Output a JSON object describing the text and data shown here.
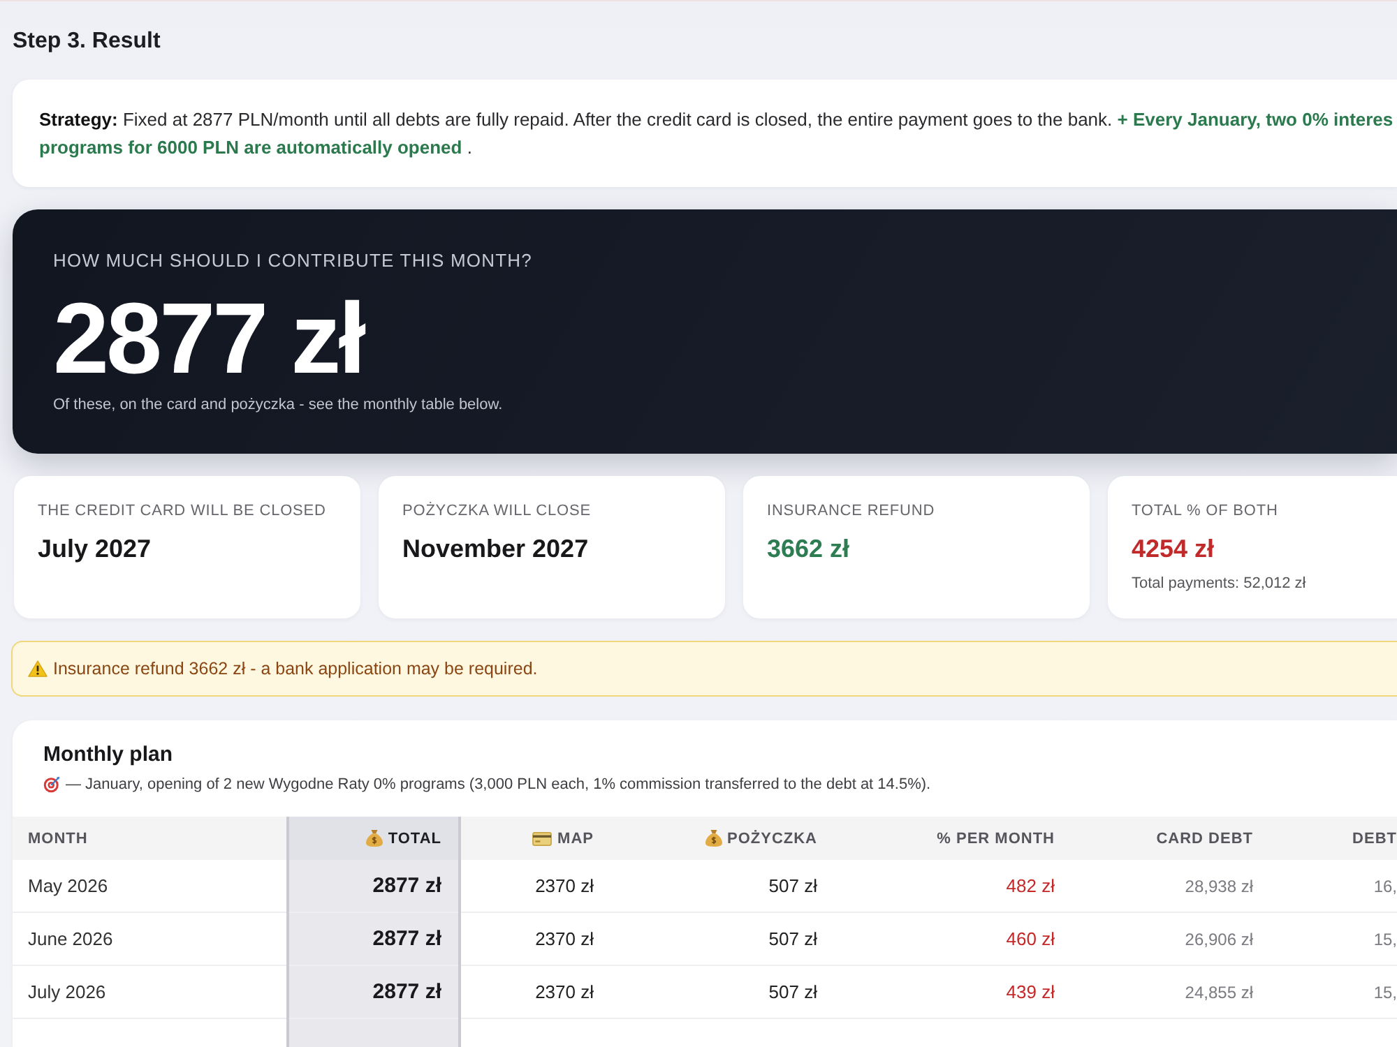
{
  "page": {
    "title": "Step 3. Result"
  },
  "strategy": {
    "label": "Strategy:",
    "text": "Fixed at 2877 PLN/month until all debts are fully repaid. After the credit card is closed, the entire payment goes to the bank.",
    "highlight": "+ Every January, two 0% interes\nprograms for 6000 PLN are automatically opened",
    "tail": "."
  },
  "hero": {
    "label": "HOW MUCH SHOULD I CONTRIBUTE THIS MONTH?",
    "amount": "2877 zł",
    "note": "Of these, on the card and pożyczka - see the monthly table below."
  },
  "stats": [
    {
      "label": "THE CREDIT CARD WILL BE CLOSED",
      "value": "July 2027",
      "kind": "neutral"
    },
    {
      "label": "POŻYCZKA WILL CLOSE",
      "value": "November 2027",
      "kind": "neutral"
    },
    {
      "label": "INSURANCE REFUND",
      "value": "3662 zł",
      "kind": "positive"
    },
    {
      "label": "TOTAL % OF BOTH",
      "value": "4254 zł",
      "kind": "negative",
      "note": "Total payments: 52,012 zł"
    }
  ],
  "alert": {
    "kind": "warning",
    "text": "Insurance refund 3662 zł - a bank application may be required."
  },
  "plan": {
    "title": "Monthly plan",
    "note": "— January, opening of 2 new Wygodne Raty 0% programs (3,000 PLN each, 1% commission transferred to the debt at 14.5%).",
    "columns": [
      {
        "label": "MONTH",
        "kind": "month"
      },
      {
        "label": "TOTAL",
        "kind": "total"
      },
      {
        "label": "MAP",
        "kind": "card"
      },
      {
        "label": "POŻYCZKA",
        "kind": "loan"
      },
      {
        "label": "% PER MONTH",
        "kind": "interest"
      },
      {
        "label": "CARD DEBT",
        "kind": "balance"
      },
      {
        "label": "DEBT",
        "kind": "balance"
      }
    ],
    "rows": [
      {
        "cells": [
          "May 2026",
          "2877 zł",
          "2370 zł",
          "507 zł",
          "482 zł",
          "28,938 zł",
          "16,"
        ]
      },
      {
        "cells": [
          "June 2026",
          "2877 zł",
          "2370 zł",
          "507 zł",
          "460 zł",
          "26,906 zł",
          "15,"
        ]
      },
      {
        "cells": [
          "July 2026",
          "2877 zł",
          "2370 zł",
          "507 zł",
          "439 zł",
          "24,855 zł",
          "15,"
        ]
      }
    ]
  }
}
